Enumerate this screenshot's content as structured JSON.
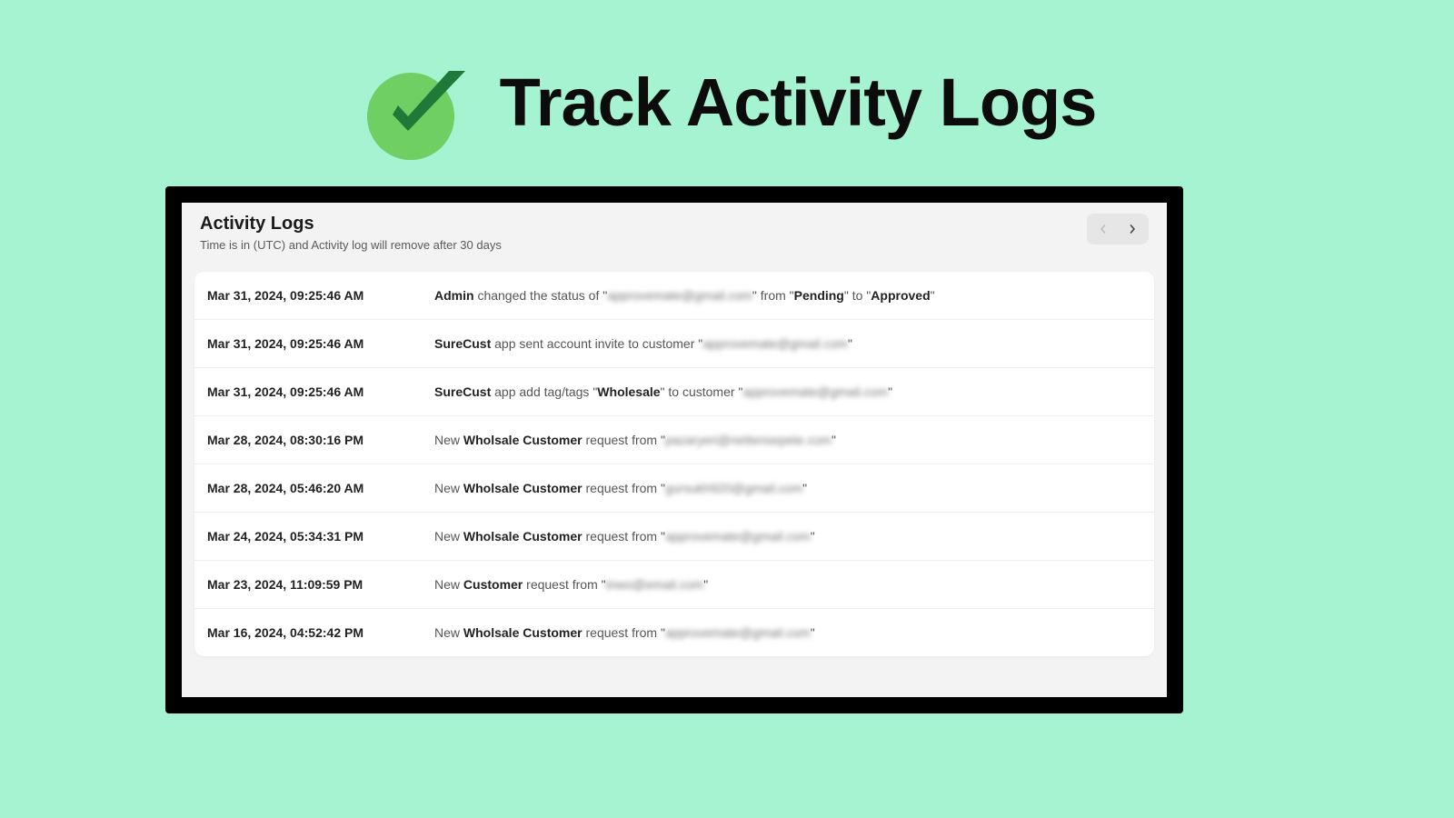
{
  "hero": {
    "title": "Track Activity Logs"
  },
  "panel": {
    "title": "Activity Logs",
    "subtitle": "Time is in (UTC) and Activity log will remove after 30 days"
  },
  "logs": [
    {
      "timestamp": "Mar 31, 2024, 09:25:46 AM",
      "parts": [
        {
          "bold": true,
          "text": "Admin"
        },
        {
          "bold": false,
          "text": " changed the status of \""
        },
        {
          "bold": false,
          "text": "approvemate@gmail.com",
          "blur": true
        },
        {
          "bold": false,
          "text": "\" from \""
        },
        {
          "bold": true,
          "text": "Pending"
        },
        {
          "bold": false,
          "text": "\" to \""
        },
        {
          "bold": true,
          "text": "Approved"
        },
        {
          "bold": false,
          "text": "\""
        }
      ]
    },
    {
      "timestamp": "Mar 31, 2024, 09:25:46 AM",
      "parts": [
        {
          "bold": true,
          "text": "SureCust"
        },
        {
          "bold": false,
          "text": " app sent account invite to customer \""
        },
        {
          "bold": false,
          "text": "approvemate@gmail.com",
          "blur": true
        },
        {
          "bold": false,
          "text": "\""
        }
      ]
    },
    {
      "timestamp": "Mar 31, 2024, 09:25:46 AM",
      "parts": [
        {
          "bold": true,
          "text": "SureCust"
        },
        {
          "bold": false,
          "text": " app add tag/tags \""
        },
        {
          "bold": true,
          "text": "Wholesale"
        },
        {
          "bold": false,
          "text": "\" to customer \""
        },
        {
          "bold": false,
          "text": "approvemate@gmail.com",
          "blur": true
        },
        {
          "bold": false,
          "text": "\""
        }
      ]
    },
    {
      "timestamp": "Mar 28, 2024, 08:30:16 PM",
      "parts": [
        {
          "bold": false,
          "text": "New "
        },
        {
          "bold": true,
          "text": "Wholsale Customer"
        },
        {
          "bold": false,
          "text": " request from \""
        },
        {
          "bold": false,
          "text": "pazaryeri@nettensepete.com",
          "blur": true
        },
        {
          "bold": false,
          "text": "\""
        }
      ]
    },
    {
      "timestamp": "Mar 28, 2024, 05:46:20 AM",
      "parts": [
        {
          "bold": false,
          "text": "New "
        },
        {
          "bold": true,
          "text": "Wholsale Customer"
        },
        {
          "bold": false,
          "text": " request from \""
        },
        {
          "bold": false,
          "text": "gursukh920@gmail.com",
          "blur": true
        },
        {
          "bold": false,
          "text": "\""
        }
      ]
    },
    {
      "timestamp": "Mar 24, 2024, 05:34:31 PM",
      "parts": [
        {
          "bold": false,
          "text": "New "
        },
        {
          "bold": true,
          "text": "Wholsale Customer"
        },
        {
          "bold": false,
          "text": " request from \""
        },
        {
          "bold": false,
          "text": "approvemate@gmail.com",
          "blur": true
        },
        {
          "bold": false,
          "text": "\""
        }
      ]
    },
    {
      "timestamp": "Mar 23, 2024, 11:09:59 PM",
      "parts": [
        {
          "bold": false,
          "text": "New "
        },
        {
          "bold": true,
          "text": "Customer"
        },
        {
          "bold": false,
          "text": " request from \""
        },
        {
          "bold": false,
          "text": "tnwo@email.com",
          "blur": true
        },
        {
          "bold": false,
          "text": "\""
        }
      ]
    },
    {
      "timestamp": "Mar 16, 2024, 04:52:42 PM",
      "parts": [
        {
          "bold": false,
          "text": "New "
        },
        {
          "bold": true,
          "text": "Wholsale Customer"
        },
        {
          "bold": false,
          "text": " request from \""
        },
        {
          "bold": false,
          "text": "approvemate@gmail.com",
          "blur": true
        },
        {
          "bold": false,
          "text": "\""
        }
      ]
    }
  ]
}
